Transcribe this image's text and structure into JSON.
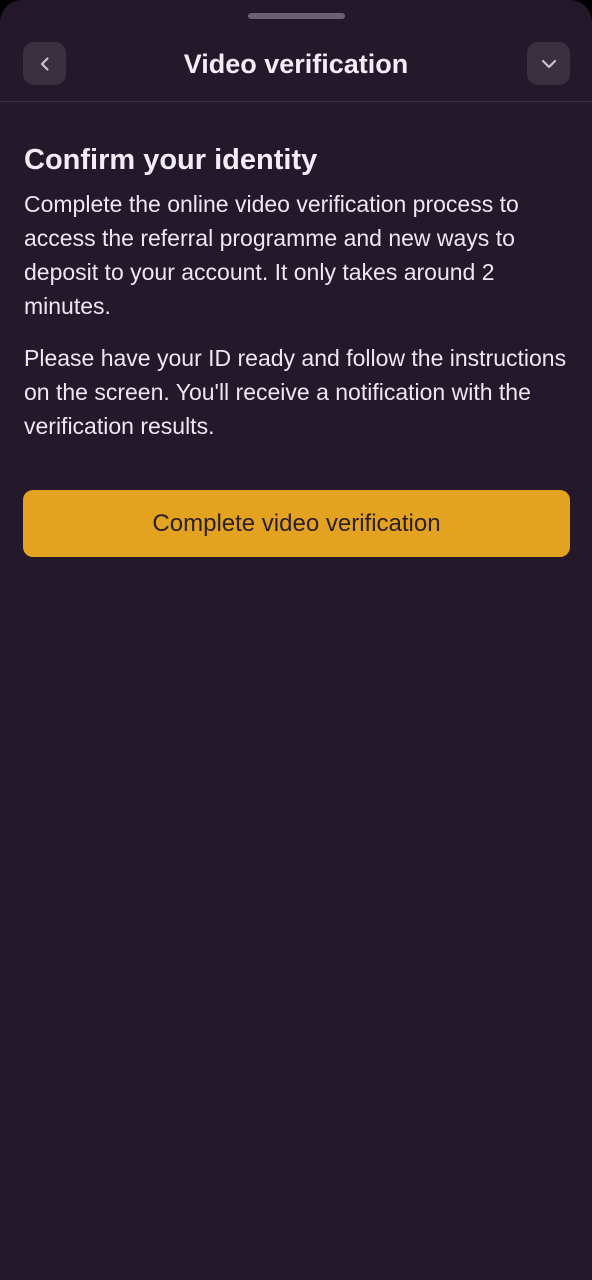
{
  "header": {
    "title": "Video verification",
    "back_icon": "chevron-left-icon",
    "collapse_icon": "chevron-down-icon"
  },
  "content": {
    "heading": "Confirm your identity",
    "paragraphs": [
      "Complete the online video verification process to access the referral programme and new ways to deposit to your account. It only takes around 2 minutes.",
      "Please have your ID ready and follow the instructions on the screen. You'll receive a notification with the verification results."
    ]
  },
  "actions": {
    "primary_label": "Complete video verification"
  },
  "colors": {
    "background": "#23192b",
    "icon_button": "#3a3040",
    "accent": "#e3a21f",
    "text": "#f3eef5"
  }
}
